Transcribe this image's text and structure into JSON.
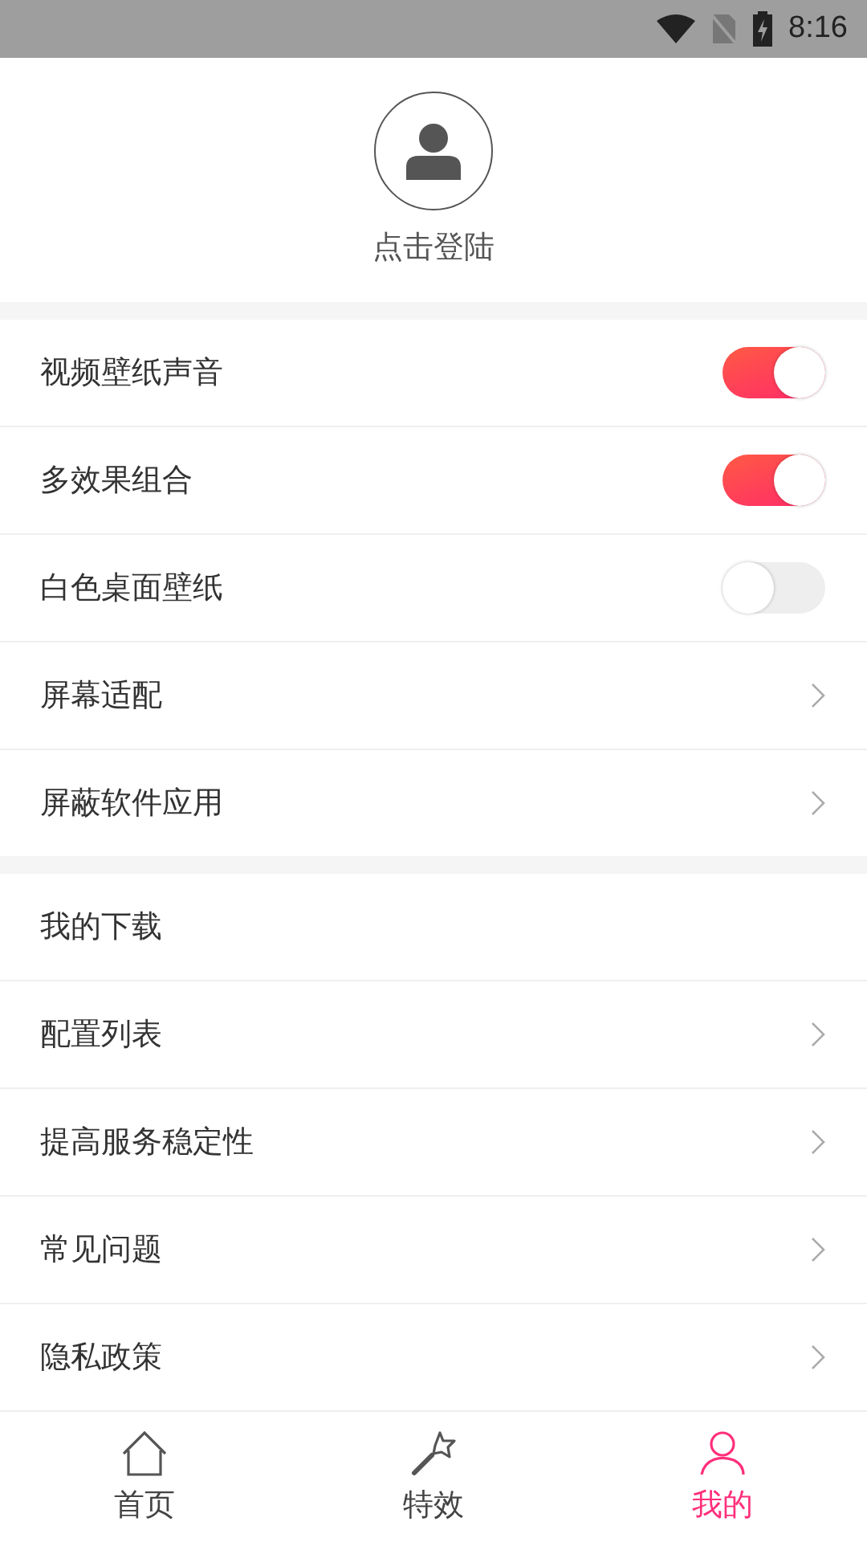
{
  "status_bar": {
    "time": "8:16"
  },
  "profile": {
    "login_label": "点击登陆"
  },
  "sections": [
    {
      "items": [
        {
          "label": "视频壁纸声音",
          "kind": "toggle",
          "on": true
        },
        {
          "label": "多效果组合",
          "kind": "toggle",
          "on": true
        },
        {
          "label": "白色桌面壁纸",
          "kind": "toggle",
          "on": false
        },
        {
          "label": "屏幕适配",
          "kind": "link"
        },
        {
          "label": "屏蔽软件应用",
          "kind": "link"
        }
      ]
    },
    {
      "items": [
        {
          "label": "我的下载",
          "kind": "plain"
        },
        {
          "label": "配置列表",
          "kind": "link"
        },
        {
          "label": "提高服务稳定性",
          "kind": "link"
        },
        {
          "label": "常见问题",
          "kind": "link"
        },
        {
          "label": "隐私政策",
          "kind": "link"
        }
      ]
    }
  ],
  "bottom_nav": [
    {
      "label": "首页",
      "kind": "home",
      "selected": false
    },
    {
      "label": "特效",
      "kind": "effects",
      "selected": false
    },
    {
      "label": "我的",
      "kind": "me",
      "selected": true
    }
  ]
}
